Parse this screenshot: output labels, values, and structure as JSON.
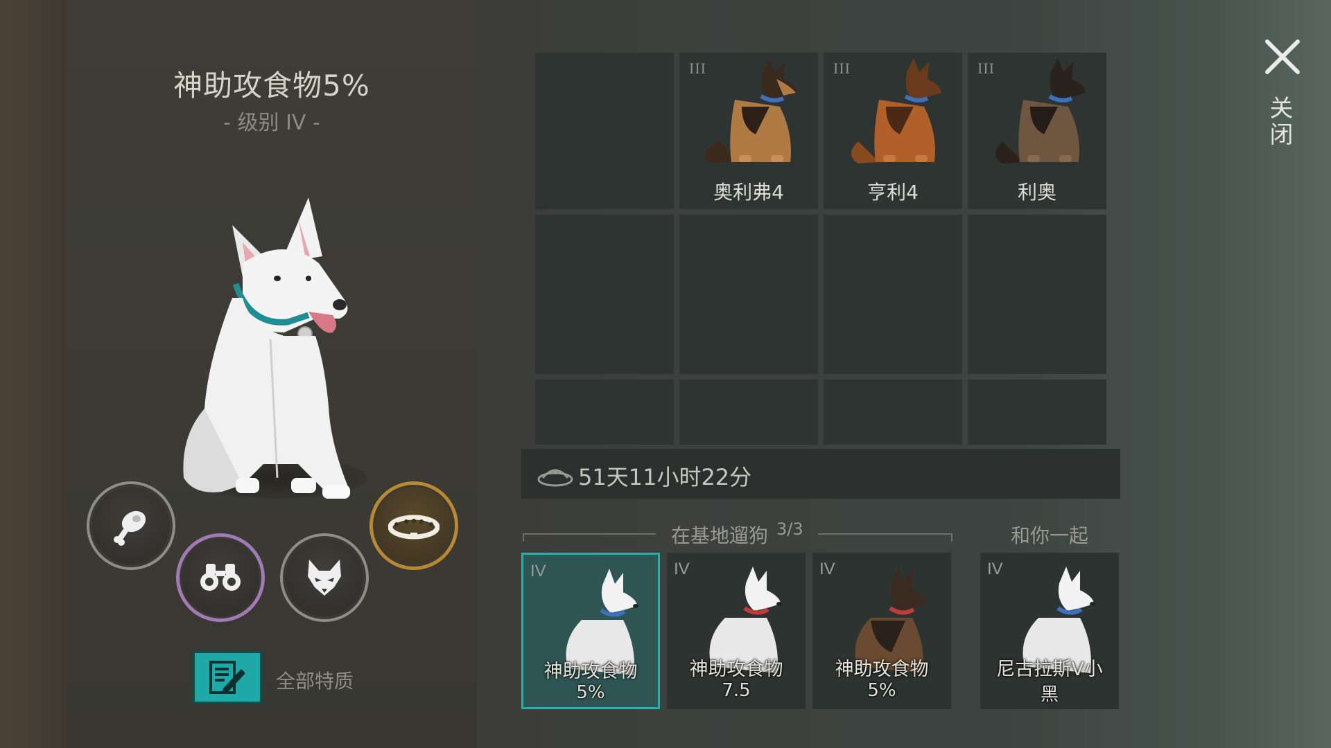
{
  "dog": {
    "title": "神助攻食物5%",
    "level": "- 级别 IV -"
  },
  "skills": [
    {
      "icon": "meat-icon",
      "color": "#8e8d86"
    },
    {
      "icon": "binoculars-icon",
      "color": "#a27bb6"
    },
    {
      "icon": "fox-head-icon",
      "color": "#8e8d86"
    },
    {
      "icon": "spiked-collar-icon",
      "color": "#b8892f"
    }
  ],
  "traits_button": {
    "label": "全部特质"
  },
  "kennel": {
    "row1": [
      {
        "level": "",
        "name": ""
      },
      {
        "level": "III",
        "name": "奥利弗4"
      },
      {
        "level": "III",
        "name": "亨利4"
      },
      {
        "level": "III",
        "name": "利奥"
      }
    ]
  },
  "timer": {
    "text": "51天11小时22分",
    "icon": "food-bowl-icon"
  },
  "walking": {
    "label": "在基地遛狗",
    "count": "3/3",
    "slots": [
      {
        "level": "IV",
        "name_line1": "神助攻食物",
        "name_line2": "5%"
      },
      {
        "level": "IV",
        "name_line1": "神助攻食物",
        "name_line2": "7.5"
      },
      {
        "level": "IV",
        "name_line1": "神助攻食物",
        "name_line2": "5%"
      }
    ]
  },
  "with_you": {
    "label": "和你一起",
    "slot": {
      "level": "IV",
      "name_line1": "尼古拉斯V小",
      "name_line2": "黑"
    }
  },
  "close": {
    "label": "关闭"
  },
  "colors": {
    "accent_teal": "#27b1ab",
    "gold": "#b8892f",
    "purple": "#a27bb6"
  }
}
